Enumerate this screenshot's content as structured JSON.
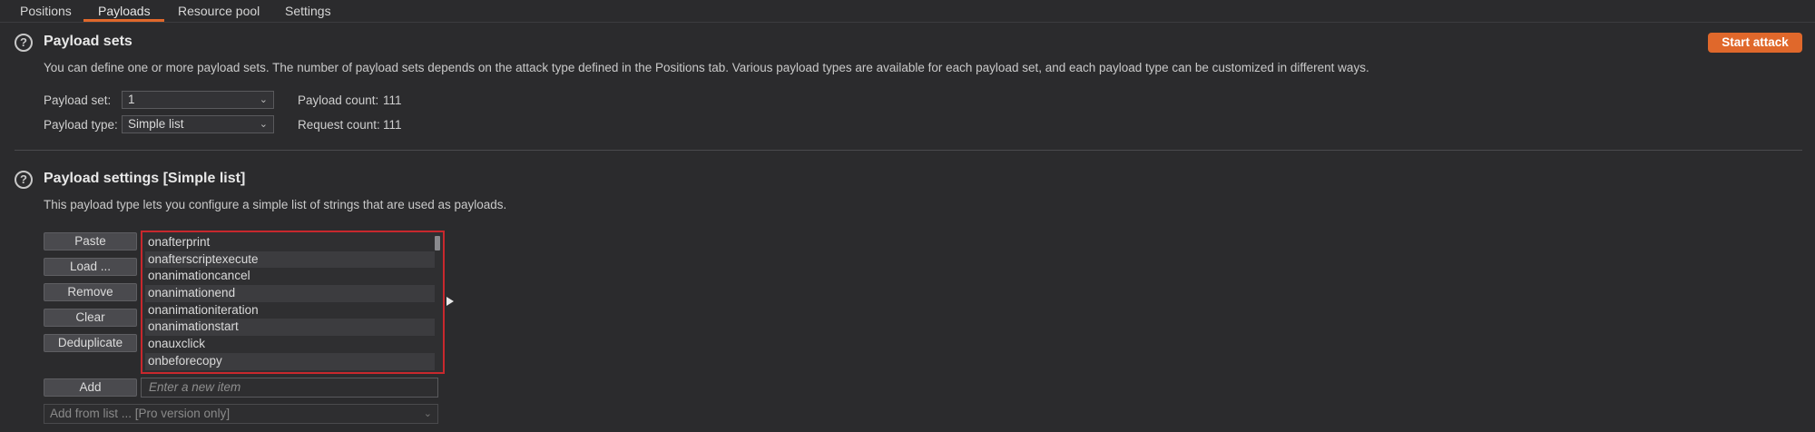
{
  "tabs": [
    {
      "label": "Positions"
    },
    {
      "label": "Payloads"
    },
    {
      "label": "Resource pool"
    },
    {
      "label": "Settings"
    }
  ],
  "payload_sets": {
    "title": "Payload sets",
    "description": "You can define one or more payload sets. The number of payload sets depends on the attack type defined in the Positions tab. Various payload types are available for each payload set, and each payload type can be customized in different ways.",
    "start_attack_label": "Start attack",
    "payload_set_label": "Payload set:",
    "payload_set_value": "1",
    "payload_type_label": "Payload type:",
    "payload_type_value": "Simple list",
    "payload_count_label": "Payload count:",
    "payload_count_value": "111",
    "request_count_label": "Request count:",
    "request_count_value": "111"
  },
  "payload_settings": {
    "title": "Payload settings [Simple list]",
    "description": "This payload type lets you configure a simple list of strings that are used as payloads.",
    "buttons": {
      "paste": "Paste",
      "load": "Load ...",
      "remove": "Remove",
      "clear": "Clear",
      "deduplicate": "Deduplicate",
      "add": "Add"
    },
    "items": [
      "onafterprint",
      "onafterscriptexecute",
      "onanimationcancel",
      "onanimationend",
      "onanimationiteration",
      "onanimationstart",
      "onauxclick",
      "onbeforecopy"
    ],
    "new_item_placeholder": "Enter a new item",
    "add_from_list_label": "Add from list ... [Pro version only]"
  },
  "colors": {
    "accent": "#e0682b",
    "selection_border": "#c8282d",
    "background": "#2b2b2d"
  },
  "icons": {
    "help": "help-circle-icon",
    "dropdown": "chevron-down-icon",
    "expand": "play-arrow-icon"
  }
}
